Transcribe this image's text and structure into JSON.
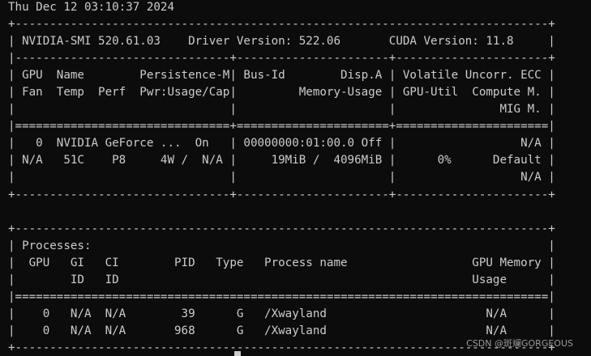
{
  "terminal": {
    "lines": [
      "Thu Dec 12 03:10:37 2024",
      "+-----------------------------------------------------------------------------+",
      "| NVIDIA-SMI 520.61.03    Driver Version: 522.06       CUDA Version: 11.8     |",
      "|-------------------------------+----------------------+----------------------+",
      "| GPU  Name        Persistence-M| Bus-Id        Disp.A | Volatile Uncorr. ECC |",
      "| Fan  Temp  Perf  Pwr:Usage/Cap|         Memory-Usage | GPU-Util  Compute M. |",
      "|                               |                      |               MIG M. |",
      "|===============================+======================+======================|",
      "|   0  NVIDIA GeForce ...  On   | 00000000:01:00.0 Off |                  N/A |",
      "| N/A   51C    P8     4W /  N/A |     19MiB /  4096MiB |      0%      Default |",
      "|                               |                      |                  N/A |",
      "+-------------------------------+----------------------+----------------------+",
      "",
      "+-----------------------------------------------------------------------------+",
      "| Processes:                                                                  |",
      "|  GPU   GI   CI        PID   Type   Process name                  GPU Memory |",
      "|        ID   ID                                                   Usage      |",
      "|=============================================================================|",
      "|    0   N/A  N/A        39      G   /Xwayland                       N/A      |",
      "|    0   N/A  N/A       968      G   /Xwayland                       N/A      |",
      "+-----------------------------------------------------------------------------+"
    ]
  },
  "watermark": {
    "text": "CSDN @斑斓GORGEOUS"
  }
}
